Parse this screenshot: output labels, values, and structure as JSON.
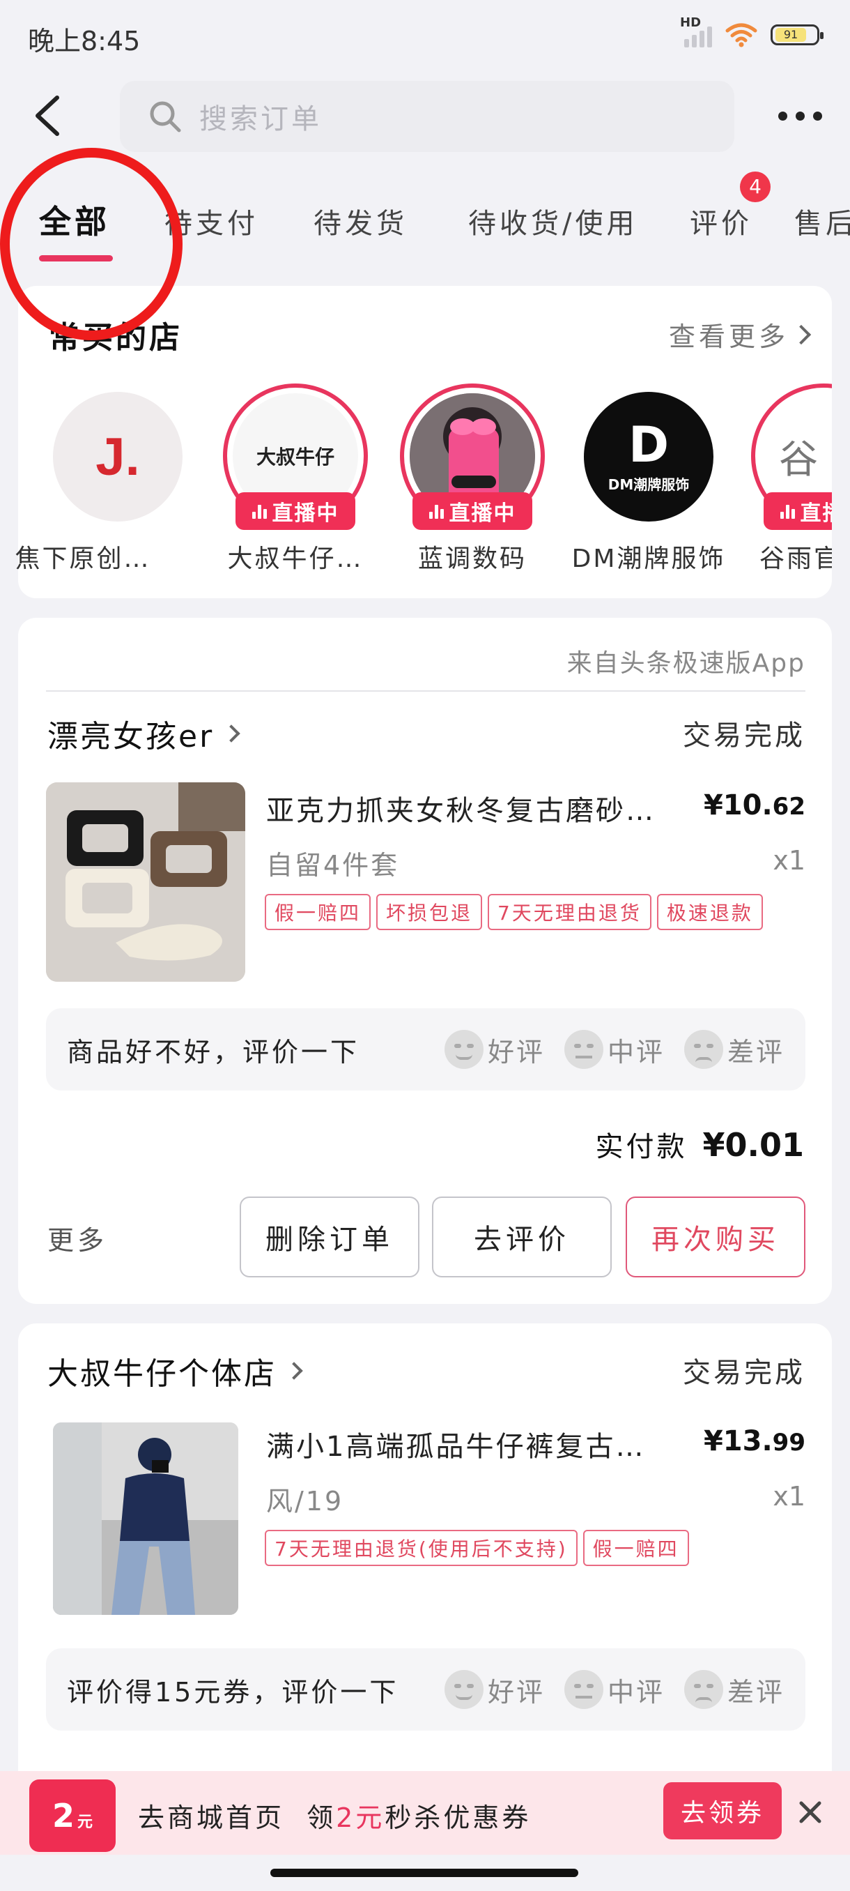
{
  "status_bar": {
    "time": "晚上8:45",
    "signal_label": "HD",
    "battery": "91"
  },
  "search": {
    "placeholder": "搜索订单"
  },
  "tabs": [
    {
      "label": "全部"
    },
    {
      "label": "待支付"
    },
    {
      "label": "待发货"
    },
    {
      "label": "待收货/使用"
    },
    {
      "label": "评价",
      "badge": "4"
    },
    {
      "label": "售后"
    }
  ],
  "frequent_shops": {
    "title": "常买的店",
    "see_more": "查看更多",
    "live_label": "直播中",
    "shops": [
      {
        "name": "焦下原创…",
        "logo_text": "J."
      },
      {
        "name": "大叔牛仔…",
        "logo_text": "大叔牛仔",
        "live": true
      },
      {
        "name": "蓝调数码",
        "live": true
      },
      {
        "name": "DM潮牌服饰",
        "logo_text": "DM潮牌服饰"
      },
      {
        "name": "谷雨官…",
        "logo_text": "谷",
        "live": true
      }
    ]
  },
  "order1": {
    "source": "来自头条极速版App",
    "store": "漂亮女孩er",
    "status": "交易完成",
    "product_title": "亚克力抓夹女秋冬复古磨砂…",
    "price_main": "¥10.",
    "price_dec": "62",
    "spec": "自留4件套",
    "qty": "x1",
    "tags": [
      "假一赔四",
      "坏损包退",
      "7天无理由退货",
      "极速退款"
    ],
    "review_prompt": "商品好不好，评价一下",
    "reviews": [
      "好评",
      "中评",
      "差评"
    ],
    "paid_label": "实付款",
    "paid_amount": "¥0.01",
    "more": "更多",
    "buttons": {
      "delete": "删除订单",
      "review": "去评价",
      "rebuy": "再次购买"
    }
  },
  "order2": {
    "store": "大叔牛仔个体店",
    "status": "交易完成",
    "product_title": "满小1高端孤品牛仔裤复古…",
    "price_main": "¥13.",
    "price_dec": "99",
    "spec": "风/19",
    "qty": "x1",
    "tags": [
      "7天无理由退货(使用后不支持)",
      "假一赔四"
    ],
    "review_prompt": "评价得15元券，评价一下",
    "reviews": [
      "好评",
      "中评",
      "差评"
    ]
  },
  "banner": {
    "coupon_value": "2",
    "coupon_unit": "元",
    "text_pre": "去商城首页  领",
    "text_hl": "2元",
    "text_post": "秒杀优惠券",
    "claim": "去领券"
  },
  "colors": {
    "accent": "#e8355e",
    "annotation_ring": "#ee1c1c"
  }
}
